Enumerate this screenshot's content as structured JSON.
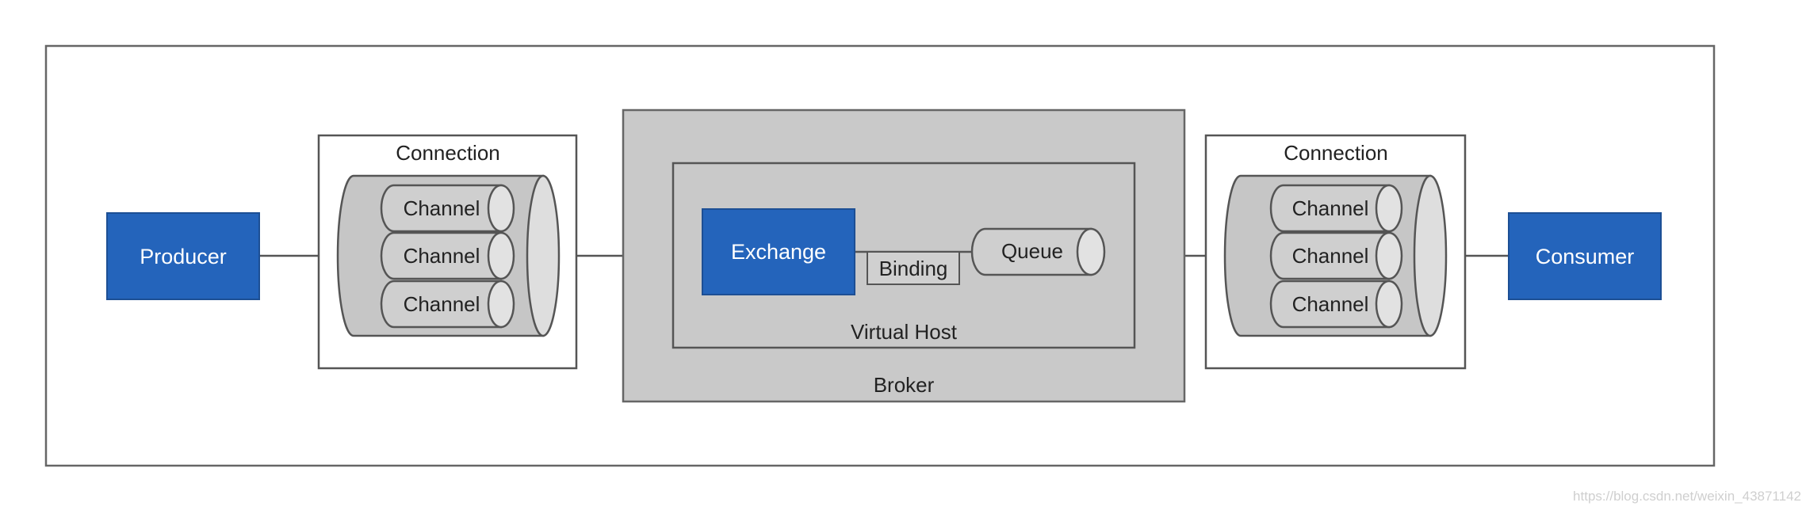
{
  "colors": {
    "node_blue": "#2464bb",
    "container_gray": "#c9c9c9",
    "cylinder_gray": "#cccccc",
    "border": "#555555"
  },
  "producer": {
    "label": "Producer"
  },
  "consumer": {
    "label": "Consumer"
  },
  "connection_left": {
    "label": "Connection",
    "channels": [
      "Channel",
      "Channel",
      "Channel"
    ]
  },
  "connection_right": {
    "label": "Connection",
    "channels": [
      "Channel",
      "Channel",
      "Channel"
    ]
  },
  "broker": {
    "label": "Broker",
    "virtual_host": {
      "label": "Virtual Host",
      "exchange": "Exchange",
      "binding": "Binding",
      "queue": "Queue"
    }
  },
  "watermark": "https://blog.csdn.net/weixin_43871142"
}
